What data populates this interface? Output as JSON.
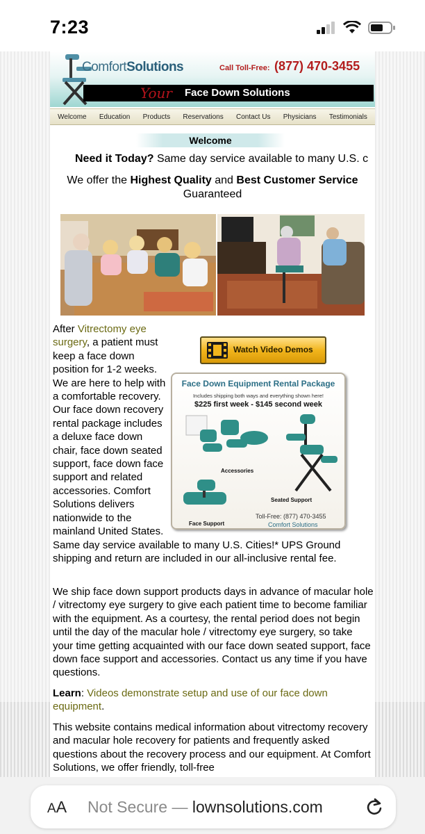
{
  "status_bar": {
    "time": "7:23"
  },
  "header": {
    "logo_plain": "Comfort",
    "logo_bold": "Solutions",
    "call_label": "Call Toll-Free:",
    "phone": "(877) 470-3455",
    "banner_script": "Your",
    "banner_text": "Face Down Solutions"
  },
  "nav": [
    "Welcome",
    "Education",
    "Products",
    "Reservations",
    "Contact Us",
    "Physicians",
    "Testimonials"
  ],
  "welcome": {
    "title": "Welcome",
    "today_bold": "Need it Today?",
    "today_text": "Same day service available to many U.S. c",
    "quality_pre": "We offer the ",
    "quality_bold1": "Highest Quality",
    "quality_mid": " and ",
    "quality_bold2": "Best Customer Service",
    "quality_post": "Guaranteed"
  },
  "video_button": {
    "label": "Watch Video Demos"
  },
  "package": {
    "title": "Face Down Equipment Rental Package",
    "subtitle": "Includes shipping both ways and everything shown here!",
    "price": "$225 first week - $145 second week",
    "label_accessories": "Accessories",
    "label_seated": "Seated Support",
    "label_face": "Face Support",
    "toll": "Toll-Free: (877) 470-3455",
    "company": "Comfort Solutions"
  },
  "paragraphs": {
    "p1_pre": "After ",
    "p1_link": "Vitrectomy eye surgery",
    "p1_post": ", a patient must keep a face down position for 1-2 weeks. We are here to help with a comfortable recovery. Our face down recovery rental package includes a deluxe face down chair, face down seated support, face down face support and related accessories. Comfort Solutions delivers nationwide to the mainland United States. Same day service available to many U.S. Cities!* UPS Ground shipping and return are included in our all-inclusive rental fee.",
    "p2": "We ship face down support products days in advance of macular hole / vitrectomy eye surgery to give each patient time to become familiar with the equipment. As a courtesy, the rental period does not begin until the day of the macular hole / vitrectomy eye surgery, so take your time getting acquainted with our face down seated support, face down face support and accessories. Contact us any time if you have questions.",
    "learn_label": "Learn",
    "learn_link": "Videos demonstrate setup and use of our face down equipment",
    "p4": "This website contains medical information about vitrectomy recovery and macular hole recovery for patients and frequently asked questions about the recovery process and our equipment. At Comfort Solutions, we offer friendly, toll-free"
  },
  "browser": {
    "aa_big": "A",
    "aa_small": "A",
    "url_prefix": "Not Secure — ",
    "url_domain": "lownsolutions.com"
  },
  "colors": {
    "link": "#6b6a13",
    "brand_red": "#b31d1d",
    "brand_teal": "#2c6f86"
  }
}
